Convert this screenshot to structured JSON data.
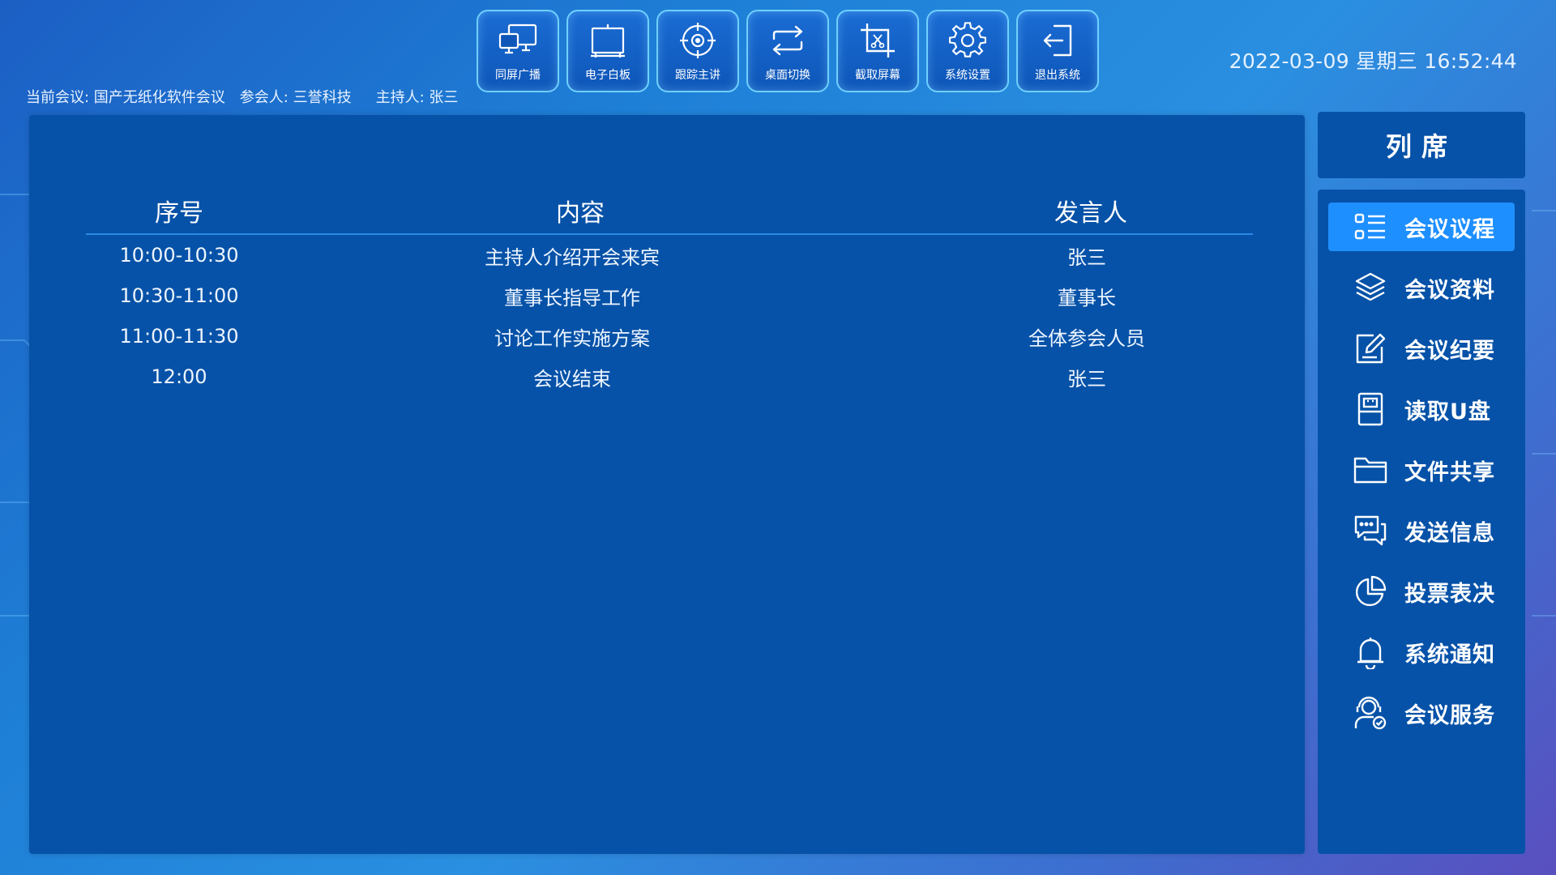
{
  "toolbar": [
    {
      "label": "同屏广播",
      "icon": "monitor-screens-icon"
    },
    {
      "label": "电子白板",
      "icon": "whiteboard-icon"
    },
    {
      "label": "跟踪主讲",
      "icon": "crosshair-target-icon"
    },
    {
      "label": "桌面切换",
      "icon": "swap-arrows-icon"
    },
    {
      "label": "截取屏幕",
      "icon": "crop-scissors-icon"
    },
    {
      "label": "系统设置",
      "icon": "gear-icon"
    },
    {
      "label": "退出系统",
      "icon": "exit-icon"
    }
  ],
  "datetime": "2022-03-09 星期三 16:52:44",
  "meeting": {
    "current": "当前会议: 国产无纸化软件会议",
    "attendee": "参会人: 三誉科技",
    "host": "主持人: 张三"
  },
  "agenda": {
    "headers": {
      "time": "序号",
      "content": "内容",
      "speaker": "发言人"
    },
    "rows": [
      {
        "time": "10:00-10:30",
        "content": "主持人介绍开会来宾",
        "speaker": "张三"
      },
      {
        "time": "10:30-11:00",
        "content": "董事长指导工作",
        "speaker": "董事长"
      },
      {
        "time": "11:00-11:30",
        "content": "讨论工作实施方案",
        "speaker": "全体参会人员"
      },
      {
        "time": "12:00",
        "content": "会议结束",
        "speaker": "张三"
      }
    ]
  },
  "sidebar": {
    "title": "列席",
    "items": [
      {
        "label": "会议议程",
        "icon": "agenda-list-icon",
        "active": true
      },
      {
        "label": "会议资料",
        "icon": "layers-icon",
        "active": false
      },
      {
        "label": "会议纪要",
        "icon": "edit-note-icon",
        "active": false
      },
      {
        "label": "读取U盘",
        "icon": "usb-drive-icon",
        "active": false
      },
      {
        "label": "文件共享",
        "icon": "folder-icon",
        "active": false
      },
      {
        "label": "发送信息",
        "icon": "chat-bubbles-icon",
        "active": false
      },
      {
        "label": "投票表决",
        "icon": "pie-chart-icon",
        "active": false
      },
      {
        "label": "系统通知",
        "icon": "bell-icon",
        "active": false
      },
      {
        "label": "会议服务",
        "icon": "service-agent-icon",
        "active": false
      }
    ]
  },
  "colors": {
    "panel": "#0652a8",
    "active": "#1e8fff",
    "toolbar_border": "#6fd0ff"
  }
}
